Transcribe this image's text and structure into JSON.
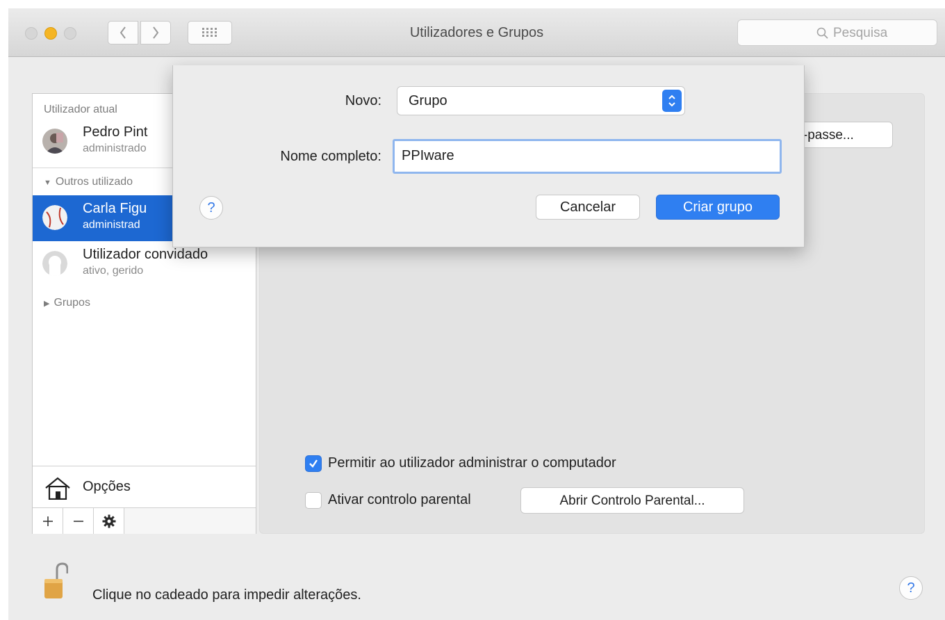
{
  "window": {
    "title": "Utilizadores e Grupos"
  },
  "search": {
    "placeholder": "Pesquisa"
  },
  "sidebar": {
    "current_section": "Utilizador atual",
    "current_user": {
      "name": "Pedro Pint",
      "role": "administrado"
    },
    "others_section": "Outros utilizado",
    "other_users": [
      {
        "name": "Carla Figu",
        "role": "administrad",
        "selected": true
      },
      {
        "name": "Utilizador convidado",
        "role": "ativo, gerido",
        "selected": false
      }
    ],
    "groups_section": "Grupos",
    "options_label": "Opções"
  },
  "panel": {
    "password_button": "ra-passe...",
    "admin_checkbox": {
      "label": "Permitir ao utilizador administrar o computador",
      "checked": true
    },
    "parental_checkbox": {
      "label": "Ativar controlo parental",
      "checked": false
    },
    "parental_button": "Abrir Controlo Parental..."
  },
  "footer": {
    "lock_text": "Clique no cadeado para impedir alterações.",
    "help": "?"
  },
  "sheet": {
    "new_label": "Novo:",
    "new_value": "Grupo",
    "fullname_label": "Nome completo:",
    "fullname_value": "PPIware",
    "help": "?",
    "cancel": "Cancelar",
    "create": "Criar grupo"
  },
  "colors": {
    "accent": "#2f7ff1",
    "selection": "#1d68d2",
    "minimize": "#f5b524",
    "lock": "#e0a445"
  }
}
